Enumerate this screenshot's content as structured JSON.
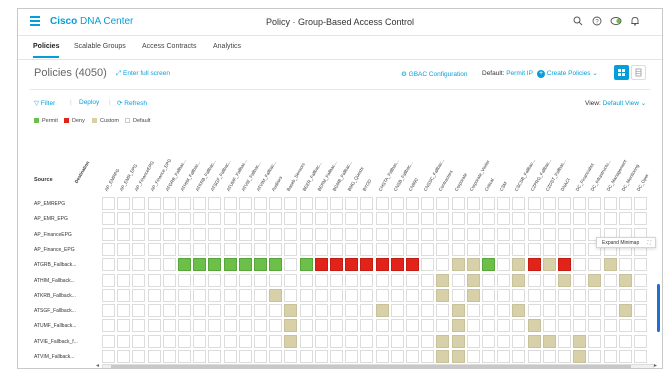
{
  "app": {
    "name_bold": "Cisco",
    "name_rest": " DNA Center",
    "title": "Policy · Group-Based Access Control"
  },
  "tabs": [
    {
      "label": "Policies",
      "active": true
    },
    {
      "label": "Scalable Groups",
      "active": false
    },
    {
      "label": "Access Contracts",
      "active": false
    },
    {
      "label": "Analytics",
      "active": false
    }
  ],
  "header": {
    "title": "Policies (4050)",
    "fullscreen": "Enter full screen",
    "gbac": "GBAC Configuration",
    "default_label": "Default:",
    "default_value": "Permit IP",
    "create": "Create Policies"
  },
  "toolbar": {
    "filter": "Filter",
    "deploy": "Deploy",
    "refresh": "Refresh",
    "view_label": "View:",
    "view_value": "Default View"
  },
  "legend": [
    {
      "label": "Permit",
      "color": "#6cc04a"
    },
    {
      "label": "Deny",
      "color": "#e2231a"
    },
    {
      "label": "Custom",
      "color": "#d7d0a8"
    },
    {
      "label": "Default",
      "color": "#ffffff"
    }
  ],
  "matrix": {
    "destination_label": "Destination",
    "source_label": "Source",
    "columns": [
      "AP_EMRPG",
      "AP_EMR_EPG",
      "AP_FinanceEPG",
      "AP_Finance_EPG",
      "ATGRB_Fallbac...",
      "ATHIM_Fallbac...",
      "ATKRB_Fallbac...",
      "ATSGF_Fallbac...",
      "ATUMF_Fallbac...",
      "ATVIE_Fallbac...",
      "ATVIM_Fallbac...",
      "Auditors",
      "Baseb_Sensors",
      "BEER_Fallbac...",
      "BERM_Fallbac...",
      "BGMB_Fallbac...",
      "BMG_Quests",
      "BYOD",
      "CHSTA_Fallbac...",
      "CNSB_Fallbac...",
      "CN990",
      "CNSSC_Fallbac...",
      "Contractors",
      "Corporate",
      "Corporate_Visitor",
      "Critical",
      "CSM",
      "CSCSB_Fallbac...",
      "CZPRG_Fallbac...",
      "CZDST_Fallbac...",
      "DNACI",
      "DC_Financialss",
      "DC_Infrastructu...",
      "DC_Management",
      "DC_Monitoring",
      "DC_Oper"
    ],
    "rows": [
      "AP_EMREPG",
      "AP_EMR_EPG",
      "AP_FinanceEPG",
      "AP_Finance_EPG",
      "ATGRB_Fallback...",
      "ATHIM_Fallback...",
      "ATKRB_Fallback...",
      "ATSGF_Fallback...",
      "ATUMF_Fallback...",
      "ATVIE_Fallback_f...",
      "ATVIM_Fallback..."
    ],
    "cells": [
      [],
      [],
      [],
      [],
      [
        [
          5,
          "P"
        ],
        [
          6,
          "P"
        ],
        [
          7,
          "P"
        ],
        [
          8,
          "P"
        ],
        [
          9,
          "P"
        ],
        [
          10,
          "P"
        ],
        [
          11,
          "P"
        ],
        [
          13,
          "P"
        ],
        [
          14,
          "D"
        ],
        [
          15,
          "D"
        ],
        [
          16,
          "D"
        ],
        [
          17,
          "D"
        ],
        [
          18,
          "D"
        ],
        [
          19,
          "D"
        ],
        [
          20,
          "D"
        ],
        [
          23,
          "C"
        ],
        [
          24,
          "C"
        ],
        [
          25,
          "P"
        ],
        [
          27,
          "C"
        ],
        [
          28,
          "D"
        ],
        [
          29,
          "C"
        ],
        [
          30,
          "D"
        ],
        [
          33,
          "C"
        ]
      ],
      [
        [
          22,
          "C"
        ],
        [
          24,
          "C"
        ],
        [
          27,
          "C"
        ],
        [
          30,
          "C"
        ],
        [
          32,
          "C"
        ],
        [
          34,
          "C"
        ]
      ],
      [
        [
          11,
          "C"
        ],
        [
          22,
          "C"
        ],
        [
          24,
          "C"
        ]
      ],
      [
        [
          12,
          "C"
        ],
        [
          18,
          "C"
        ],
        [
          23,
          "C"
        ],
        [
          27,
          "C"
        ],
        [
          34,
          "C"
        ]
      ],
      [
        [
          12,
          "C"
        ],
        [
          23,
          "C"
        ],
        [
          28,
          "C"
        ]
      ],
      [
        [
          12,
          "C"
        ],
        [
          22,
          "C"
        ],
        [
          23,
          "C"
        ],
        [
          28,
          "C"
        ],
        [
          29,
          "C"
        ],
        [
          31,
          "C"
        ]
      ],
      [
        [
          22,
          "C"
        ],
        [
          23,
          "C"
        ],
        [
          31,
          "C"
        ]
      ]
    ]
  },
  "tooltip": "Expand Minimap"
}
